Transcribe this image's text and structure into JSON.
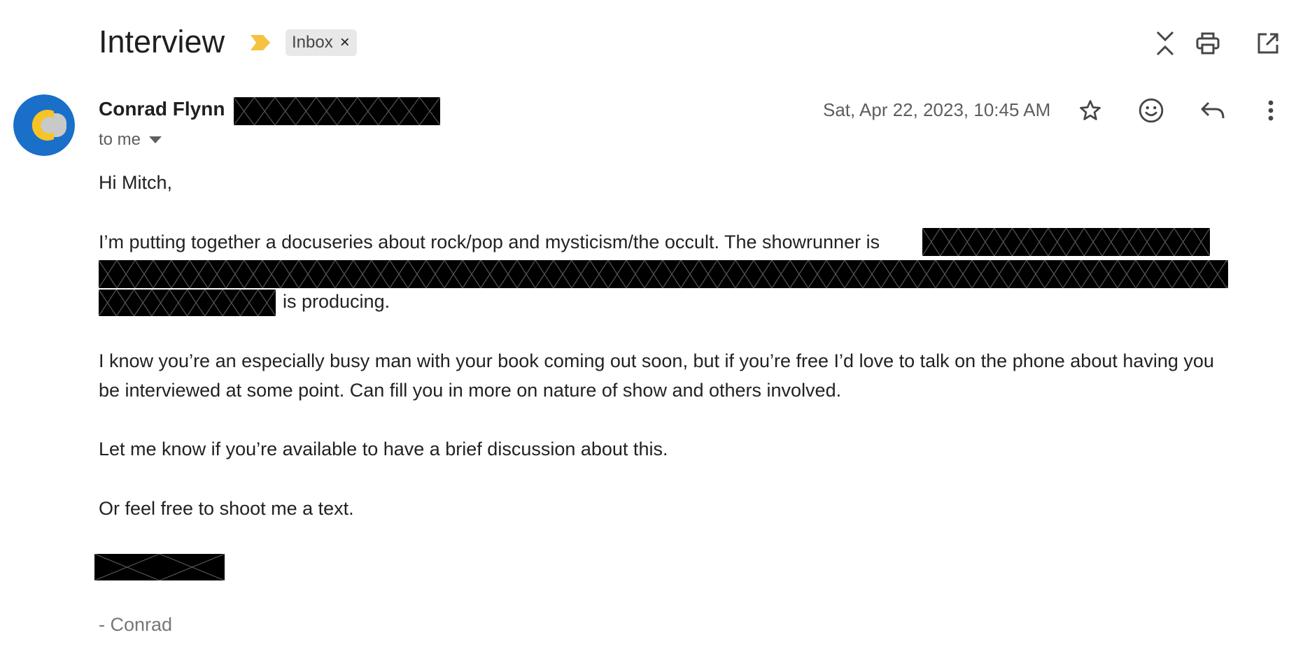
{
  "thread": {
    "subject": "Interview",
    "label": "Inbox",
    "label_remove": "×"
  },
  "toolbar": {
    "icons": [
      "expand-collapse-icon",
      "print-icon",
      "open-new-window-icon"
    ]
  },
  "message": {
    "sender_name": "Conrad Flynn",
    "recipients": "to me",
    "date": "Sat, Apr 22, 2023, 10:45 AM",
    "actions": [
      "star-icon",
      "emoji-icon",
      "reply-icon",
      "more-vert-icon"
    ],
    "body": {
      "greeting": "Hi Mitch,",
      "p1_start": "I’m putting together a docuseries about rock/pop and mysticism/the occult. The showrunner is",
      "p1_end": "is producing.",
      "p2_line1": "I know you’re an especially busy man with your book coming out soon, but if you’re free I’d love  to talk on the phone about having you",
      "p2_line2": "be interviewed at some point. Can fill you in more on nature of show and others involved.",
      "p3": "Let me know if you’re available to have a brief discussion about this.",
      "p4": "Or feel free to shoot me a text.",
      "signature": "- Conrad"
    }
  },
  "colors": {
    "importance_marker": "#f5c242",
    "avatar_blue": "#1a6fc9",
    "avatar_yellow": "#f7c325",
    "avatar_grey": "#c9c9c9"
  }
}
